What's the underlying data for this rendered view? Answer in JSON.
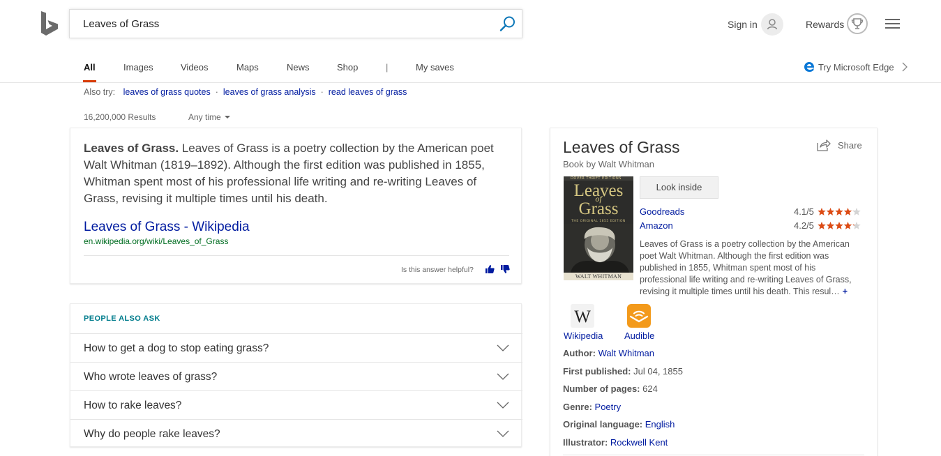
{
  "search": {
    "query": "Leaves of Grass"
  },
  "header": {
    "signin_label": "Sign in",
    "rewards_label": "Rewards"
  },
  "tabs": [
    "All",
    "Images",
    "Videos",
    "Maps",
    "News",
    "Shop",
    "|",
    "My saves"
  ],
  "edge_promo": "Try Microsoft Edge",
  "also_try": {
    "label": "Also try:",
    "items": [
      "leaves of grass quotes",
      "leaves of grass analysis",
      "read leaves of grass"
    ]
  },
  "results": {
    "count": "16,200,000 Results",
    "time_filter": "Any time"
  },
  "answer": {
    "title": "Leaves of Grass.",
    "text": "Leaves of Grass is a poetry collection by the American poet Walt Whitman (1819–1892). Although the first edition was published in 1855, Whitman spent most of his professional life writing and re-writing Leaves of Grass, revising it multiple times until his death.",
    "link_title": "Leaves of Grass - Wikipedia",
    "link_url": "en.wikipedia.org/wiki/Leaves_of_Grass",
    "helpful_label": "Is this answer helpful?"
  },
  "people_also_ask": {
    "title": "PEOPLE ALSO ASK",
    "questions": [
      "How to get a dog to stop eating grass?",
      "Who wrote leaves of grass?",
      "How to rake leaves?",
      "Why do people rake leaves?"
    ]
  },
  "knowledge_panel": {
    "title": "Leaves of Grass",
    "subtitle": "Book by Walt Whitman",
    "share_label": "Share",
    "look_inside_label": "Look inside",
    "cover": {
      "series": "DOVER THRIFT EDITIONS",
      "title_line1": "Leaves",
      "title_line2": "of",
      "title_line3": "Grass",
      "edition": "THE ORIGINAL 1855 EDITION",
      "author": "WALT WHITMAN"
    },
    "ratings": [
      {
        "source": "Goodreads",
        "score": "4.1/5",
        "stars": 4.1
      },
      {
        "source": "Amazon",
        "score": "4.2/5",
        "stars": 4.2
      }
    ],
    "description": "Leaves of Grass is a poetry collection by the American poet Walt Whitman. Although the first edition was published in 1855, Whitman spent most of his professional life writing and re-writing Leaves of Grass, revising it multiple times until his death. This resul…",
    "more_symbol": "+",
    "sources": [
      {
        "label": "Wikipedia",
        "icon": "wikipedia-icon"
      },
      {
        "label": "Audible",
        "icon": "audible-icon"
      }
    ],
    "facts": [
      {
        "key": "Author:",
        "value": "Walt Whitman",
        "link": true
      },
      {
        "key": "First published:",
        "value": "Jul 04, 1855",
        "link": false
      },
      {
        "key": "Number of pages:",
        "value": "624",
        "link": false
      },
      {
        "key": "Genre:",
        "value": "Poetry",
        "link": true
      },
      {
        "key": "Original language:",
        "value": "English",
        "link": true
      },
      {
        "key": "Illustrator:",
        "value": "Rockwell Kent",
        "link": true
      }
    ]
  },
  "colors": {
    "accent_orange": "#d83b01",
    "link_blue": "#001ba0",
    "url_green": "#006d21",
    "paa_teal": "#007c8c",
    "star_orange": "#dd4b14"
  }
}
